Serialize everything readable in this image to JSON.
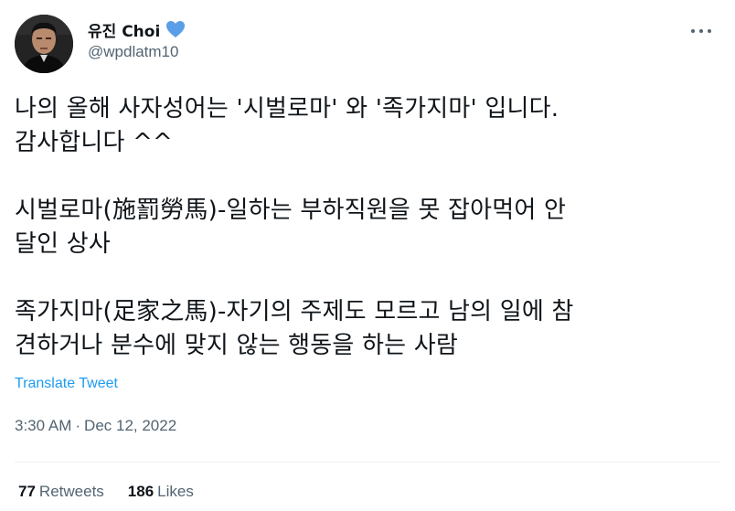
{
  "author": {
    "display_name": "유진 Choi",
    "handle": "@wpdlatm10",
    "badge_icon": "blue-heart-icon",
    "badge_color": "#5b9ee8"
  },
  "tweet": {
    "lines": [
      "나의 올해 사자성어는 '시벌로마' 와 '족가지마' 입니다.",
      "감사합니다 ^^",
      "",
      "시벌로마(施罰勞馬)-일하는 부하직원을 못 잡아먹어 안",
      "달인 상사",
      "",
      "족가지마(足家之馬)-자기의 주제도 모르고 남의 일에 참",
      "견하거나 분수에 맞지 않는 행동을 하는 사람"
    ],
    "translate_label": "Translate Tweet",
    "time": "3:30 AM",
    "separator": "·",
    "date": "Dec 12, 2022"
  },
  "stats": {
    "retweets_count": "77",
    "retweets_label": "Retweets",
    "likes_count": "186",
    "likes_label": "Likes"
  },
  "colors": {
    "text": "#0f1419",
    "secondary": "#536471",
    "link": "#1d9bf0",
    "divider": "#eff3f4"
  },
  "icons": {
    "more": "more-horizontal-icon",
    "avatar": "profile-photo"
  }
}
